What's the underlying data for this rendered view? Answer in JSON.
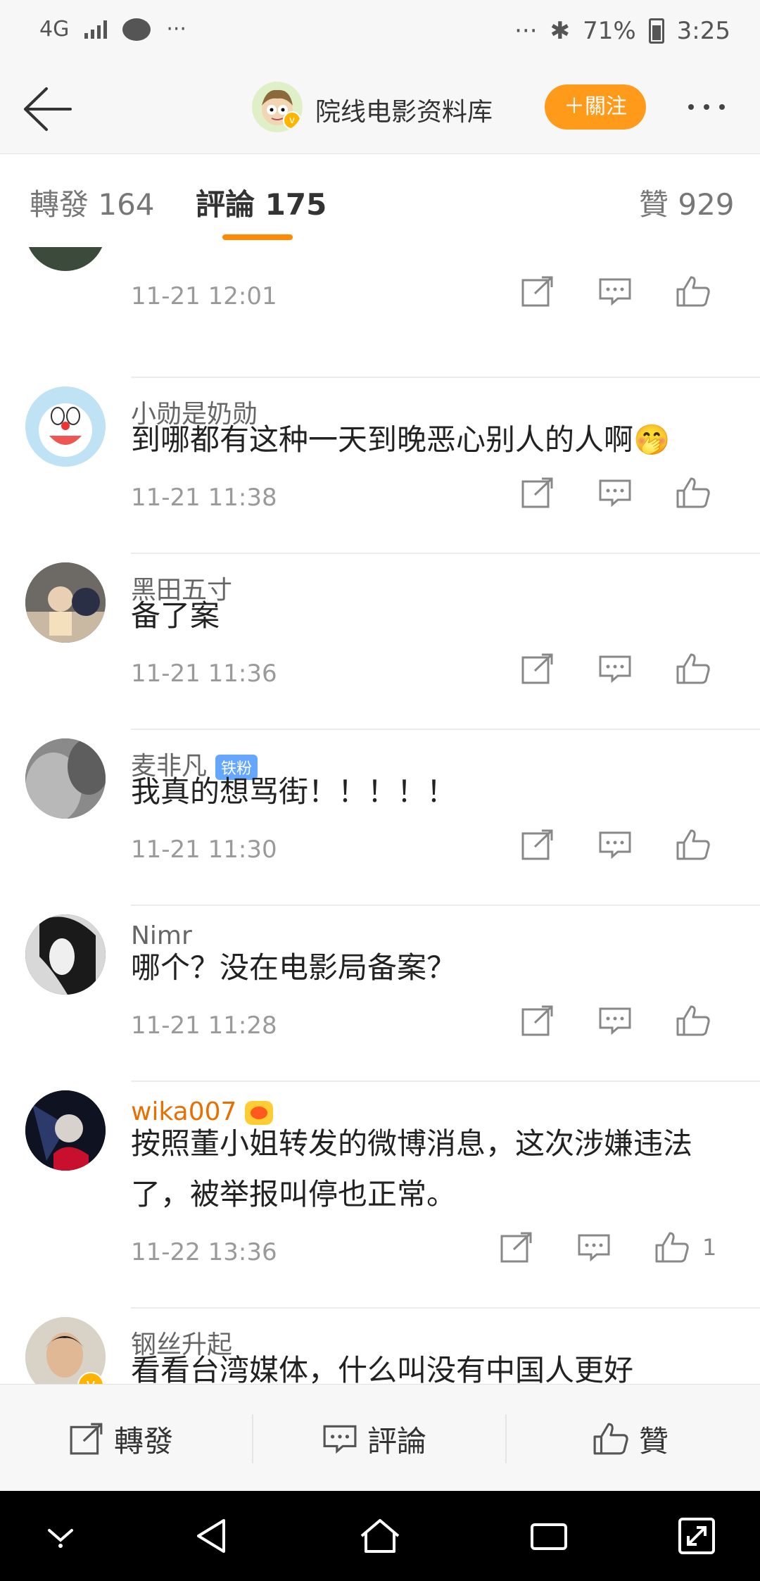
{
  "status_bar": {
    "network": "4G",
    "overflow": "···",
    "battery": "71%",
    "time": "3:25"
  },
  "header": {
    "account_name": "院线电影资料库",
    "follow_label": "＋關注"
  },
  "tabs": [
    {
      "label": "轉發 164"
    },
    {
      "label": "評論 175"
    },
    {
      "label": "贊 929"
    }
  ],
  "comments": [
    {
      "name": "",
      "text": "",
      "time": "11-21 12:01"
    },
    {
      "name": "小勋是奶勋",
      "text": "到哪都有这种一天到晚恶心别人的人啊🤭",
      "time": "11-21 11:38"
    },
    {
      "name": "黑田五寸",
      "text": "备了案",
      "time": "11-21 11:36"
    },
    {
      "name": "麦非凡",
      "badge": "铁粉",
      "text": "我真的想骂街！！！！！",
      "time": "11-21 11:30"
    },
    {
      "name": "Nimr",
      "text": "哪个？没在电影局备案？",
      "time": "11-21 11:28"
    },
    {
      "name": "wika007",
      "text": "按照董小姐转发的微博消息，这次涉嫌违法了，被举报叫停也正常。",
      "time": "11-22 13:36",
      "likes": "1"
    },
    {
      "name": "钢丝升起",
      "text": "看看台湾媒体，什么叫没有中国人更好",
      "time": ""
    }
  ],
  "bottom_bar": {
    "repost": "轉發",
    "comment": "評論",
    "like": "贊"
  },
  "colors": {
    "accent": "#ff8a00",
    "follow_bg": "#ff9a1a",
    "vip_name": "#e86f00"
  }
}
